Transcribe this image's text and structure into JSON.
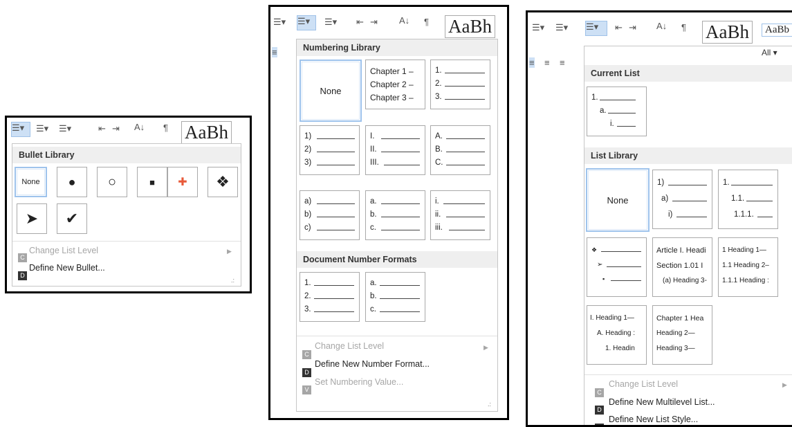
{
  "bullet_panel": {
    "toolbar_sample": "AaBh",
    "header": "Bullet Library",
    "items": [
      {
        "label": "None",
        "glyph": ""
      },
      {
        "label": "",
        "glyph": "●"
      },
      {
        "label": "",
        "glyph": "○"
      },
      {
        "label": "",
        "glyph": "■"
      },
      {
        "label": "",
        "glyph": "✚"
      },
      {
        "label": "",
        "glyph": "❖"
      },
      {
        "label": "",
        "glyph": "➤"
      },
      {
        "label": "",
        "glyph": "✔"
      }
    ],
    "change_list_level": {
      "key": "C",
      "label": "Change List Level"
    },
    "define_new": {
      "key": "D",
      "label": "Define New Bullet..."
    }
  },
  "numbering_panel": {
    "toolbar_sample": "AaBh",
    "library_header": "Numbering Library",
    "none_label": "None",
    "library": [
      [
        "Chapter 1 –",
        "Chapter 2 –",
        "Chapter 3 –"
      ],
      [
        "1.",
        "2.",
        "3."
      ],
      [
        "1)",
        "2)",
        "3)"
      ],
      [
        "I.",
        "II.",
        "III."
      ],
      [
        "A.",
        "B.",
        "C."
      ],
      [
        "a)",
        "b)",
        "c)"
      ],
      [
        "a.",
        "b.",
        "c."
      ],
      [
        "i.",
        "ii.",
        "iii."
      ]
    ],
    "document_header": "Document Number Formats",
    "document_formats": [
      [
        "1.",
        "2.",
        "3."
      ],
      [
        "a.",
        "b.",
        "c."
      ]
    ],
    "change_list_level": {
      "key": "C",
      "label": "Change List Level"
    },
    "define_new": {
      "key": "D",
      "label": "Define New Number Format..."
    },
    "set_value": {
      "key": "V",
      "label": "Set Numbering Value..."
    }
  },
  "multilevel_panel": {
    "toolbar_sample": "AaBh",
    "toolbar_sample_small": "AaBb",
    "filter_label": "All ▾",
    "current_header": "Current List",
    "current_list": [
      "1.",
      "a.",
      "i."
    ],
    "library_header": "List Library",
    "none_label": "None",
    "library": [
      [
        "1)",
        "a)",
        "i)"
      ],
      [
        "1.",
        "1.1.",
        "1.1.1."
      ],
      [
        "❖",
        "➢",
        "▪"
      ],
      [
        "Article I. Headi",
        "Section 1.01 I",
        "(a) Heading 3-"
      ],
      [
        "1 Heading 1—",
        "1.1 Heading 2–",
        "1.1.1 Heading :"
      ],
      [
        "I. Heading 1—",
        "A. Heading :",
        "1. Headin"
      ],
      [
        "Chapter 1 Hea",
        "Heading 2—",
        "Heading 3—"
      ]
    ],
    "change_list_level": {
      "key": "C",
      "label": "Change List Level"
    },
    "define_new": {
      "key": "D",
      "label": "Define New Multilevel List..."
    },
    "define_style": {
      "key": "L",
      "label": "Define New List Style..."
    }
  }
}
